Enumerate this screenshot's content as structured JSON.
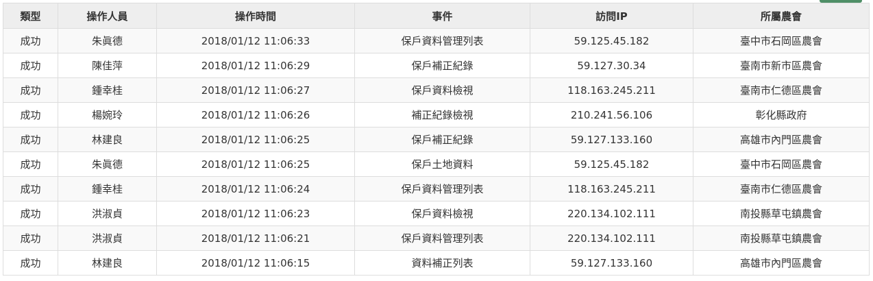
{
  "table": {
    "headers": [
      "類型",
      "操作人員",
      "操作時間",
      "事件",
      "訪問IP",
      "所屬農會"
    ],
    "rows": [
      [
        "成功",
        "朱眞德",
        "2018/01/12 11:06:33",
        "保戶資料管理列表",
        "59.125.45.182",
        "臺中市石岡區農會"
      ],
      [
        "成功",
        "陳佳萍",
        "2018/01/12 11:06:29",
        "保戶補正紀錄",
        "59.127.30.34",
        "臺南市新市區農會"
      ],
      [
        "成功",
        "鍾幸桂",
        "2018/01/12 11:06:27",
        "保戶資料檢視",
        "118.163.245.211",
        "臺南市仁德區農會"
      ],
      [
        "成功",
        "楊婉玲",
        "2018/01/12 11:06:26",
        "補正紀錄檢視",
        "210.241.56.106",
        "彰化縣政府"
      ],
      [
        "成功",
        "林建良",
        "2018/01/12 11:06:25",
        "保戶補正紀錄",
        "59.127.133.160",
        "高雄市內門區農會"
      ],
      [
        "成功",
        "朱眞德",
        "2018/01/12 11:06:25",
        "保戶土地資料",
        "59.125.45.182",
        "臺中市石岡區農會"
      ],
      [
        "成功",
        "鍾幸桂",
        "2018/01/12 11:06:24",
        "保戶資料管理列表",
        "118.163.245.211",
        "臺南市仁德區農會"
      ],
      [
        "成功",
        "洪淑貞",
        "2018/01/12 11:06:23",
        "保戶資料檢視",
        "220.134.102.111",
        "南投縣草屯鎮農會"
      ],
      [
        "成功",
        "洪淑貞",
        "2018/01/12 11:06:21",
        "保戶資料管理列表",
        "220.134.102.111",
        "南投縣草屯鎮農會"
      ],
      [
        "成功",
        "林建良",
        "2018/01/12 11:06:15",
        "資料補正列表",
        "59.127.133.160",
        "高雄市內門區農會"
      ]
    ]
  },
  "colors": {
    "header_bg": "#eeeeee",
    "striped_row_bg": "#f9f9f9",
    "border": "#dddddd",
    "accent": "#4f8f67"
  }
}
